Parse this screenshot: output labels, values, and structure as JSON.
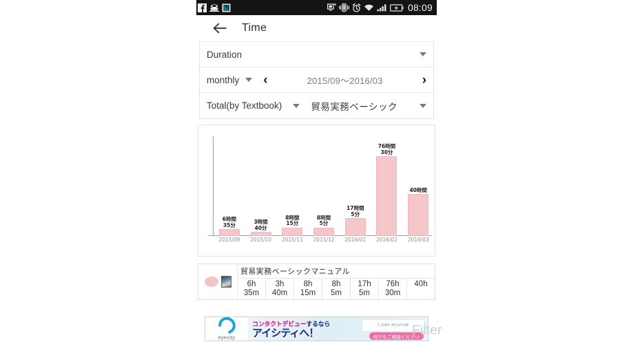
{
  "statusbar": {
    "time": "08:09",
    "left_icons": [
      "facebook-icon",
      "coffee-cup-icon",
      "app-tile-icon"
    ],
    "right_icons": [
      "screen-mirror-icon",
      "vibrate-icon",
      "alarm-icon",
      "wifi-icon",
      "signal-icon",
      "battery-charging-icon"
    ]
  },
  "appbar": {
    "back_label": "←",
    "title": "Time"
  },
  "filters": {
    "duration_label": "Duration",
    "period_label": "monthly",
    "prev_label": "‹",
    "next_label": "›",
    "range": "2015/09〜2016/03",
    "aggregate_label": "Total(by Textbook)",
    "textbook_label": "貿易実務ベーシック"
  },
  "chart_data": {
    "type": "bar",
    "title": "",
    "xlabel": "",
    "ylabel": "",
    "categories": [
      "2015/09",
      "2015/10",
      "2015/11",
      "2015/12",
      "2016/01",
      "2016/02",
      "2016/03"
    ],
    "values": [
      6.583,
      3.667,
      8.25,
      8.083,
      17.083,
      76.5,
      40
    ],
    "unit": "hours",
    "ylim": [
      0,
      80
    ],
    "grid": false,
    "legend_position": "below-table",
    "data_labels": [
      "6時間\n35分",
      "3時間\n40分",
      "8時間\n15分",
      "8時間\n5分",
      "17時間\n5分",
      "76時間\n30分",
      "40時間"
    ],
    "data_labels_lines": [
      [
        "6時間",
        "35分"
      ],
      [
        "3時間",
        "40分"
      ],
      [
        "8時間",
        "15分"
      ],
      [
        "8時間",
        "5分"
      ],
      [
        "17時間",
        "5分"
      ],
      [
        "76時間",
        "30分"
      ],
      [
        "40時間",
        ""
      ]
    ],
    "bar_color": "#f6c7ca",
    "axis_color": "#9d9d9d"
  },
  "legend": {
    "title": "貿易実務ベーシックマニュアル",
    "swatch_color": "#f4c3c6",
    "cells": [
      [
        "6h",
        "35m"
      ],
      [
        "3h",
        "40m"
      ],
      [
        "8h",
        "15m"
      ],
      [
        "8h",
        "5m"
      ],
      [
        "17h",
        "5m"
      ],
      [
        "76h",
        "30m"
      ],
      [
        "40h",
        ""
      ]
    ]
  },
  "ad": {
    "brand": "eyecity",
    "line1_pink": "コンタクトデビュー",
    "line1_dark": "するなら",
    "line2": "アイシティへ！",
    "pill": "何でもご相談ください",
    "lens_text": "1-DAY ACUVUE"
  },
  "overlay": {
    "text": "Filter"
  }
}
